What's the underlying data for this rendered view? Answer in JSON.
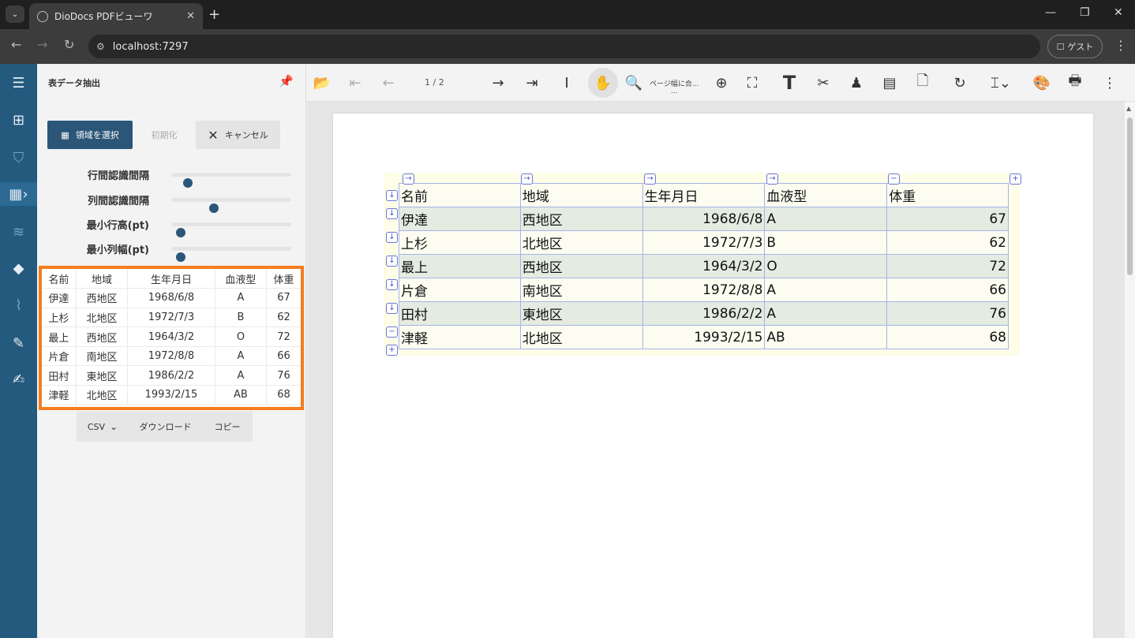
{
  "browser": {
    "tab_title": "DioDocs PDFビューワ",
    "address": "localhost:7297",
    "profile_label": "ゲスト"
  },
  "panel": {
    "title": "表データ抽出",
    "select_region_label": "領域を選択",
    "reset_label": "初期化",
    "cancel_label": "キャンセル",
    "sliders": [
      {
        "label": "行間認識間隔",
        "level": 0.07
      },
      {
        "label": "列間認識間隔",
        "level": 0.33
      },
      {
        "label": "最小行高(pt)",
        "level": 0.0
      },
      {
        "label": "最小列幅(pt)",
        "level": 0.0
      }
    ],
    "format_label": "CSV",
    "download_label": "ダウンロード",
    "copy_label": "コピー"
  },
  "table": {
    "headers": [
      "名前",
      "地域",
      "生年月日",
      "血液型",
      "体重"
    ],
    "rows": [
      [
        "伊達",
        "西地区",
        "1968/6/8",
        "A",
        "67"
      ],
      [
        "上杉",
        "北地区",
        "1972/7/3",
        "B",
        "62"
      ],
      [
        "最上",
        "西地区",
        "1964/3/2",
        "O",
        "72"
      ],
      [
        "片倉",
        "南地区",
        "1972/8/8",
        "A",
        "66"
      ],
      [
        "田村",
        "東地区",
        "1986/2/2",
        "A",
        "76"
      ],
      [
        "津軽",
        "北地区",
        "1993/2/15",
        "AB",
        "68"
      ]
    ]
  },
  "viewer": {
    "page_indicator": "1 / 2",
    "zoom_label": "ページ幅に合...",
    "zoom_label_sub": "..."
  },
  "colors": {
    "accent": "#2b5678",
    "nav_bg": "#235a7e",
    "highlight": "#f47d20"
  }
}
